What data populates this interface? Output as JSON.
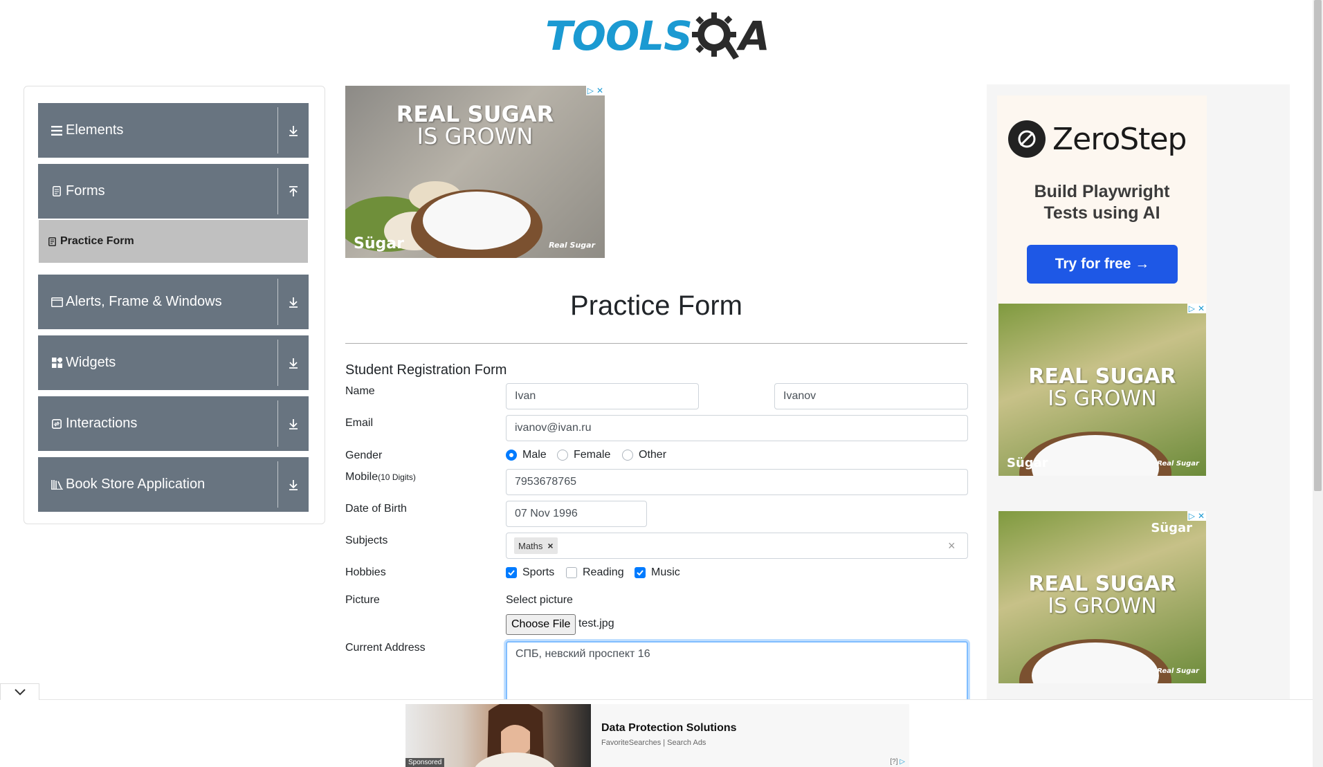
{
  "header": {
    "logo_text": "TOOLS",
    "logo_suffix": "A"
  },
  "sidebar": {
    "groups": [
      {
        "label": "Elements",
        "icon": "menu-icon",
        "toggle": "download-icon"
      },
      {
        "label": "Forms",
        "icon": "document-icon",
        "toggle": "upload-icon"
      },
      {
        "label": "Alerts, Frame & Windows",
        "icon": "window-icon",
        "toggle": "download-icon"
      },
      {
        "label": "Widgets",
        "icon": "widgets-icon",
        "toggle": "download-icon"
      },
      {
        "label": "Interactions",
        "icon": "interactions-icon",
        "toggle": "download-icon"
      },
      {
        "label": "Book Store Application",
        "icon": "books-icon",
        "toggle": "download-icon"
      }
    ],
    "active_item": {
      "label": "Practice Form",
      "icon": "form-icon"
    }
  },
  "top_ad": {
    "line1": "REAL SUGAR",
    "line2": "IS GROWN",
    "brand": "Sügar",
    "badge": "Real Sugar"
  },
  "main": {
    "page_title": "Practice Form",
    "form_title": "Student Registration Form",
    "labels": {
      "name": "Name",
      "email": "Email",
      "gender": "Gender",
      "mobile": "Mobile",
      "mobile_hint": "(10 Digits)",
      "dob": "Date of Birth",
      "subjects": "Subjects",
      "hobbies": "Hobbies",
      "picture": "Picture",
      "address": "Current Address"
    },
    "first_name": "Ivan",
    "last_name": "Ivanov",
    "email": "ivanov@ivan.ru",
    "gender_options": [
      "Male",
      "Female",
      "Other"
    ],
    "gender_selected": "Male",
    "mobile": "7953678765",
    "dob": "07 Nov 1996",
    "subjects": [
      "Maths"
    ],
    "subject_remove": "×",
    "subjects_clear": "×",
    "hobbies": [
      {
        "label": "Sports",
        "checked": true
      },
      {
        "label": "Reading",
        "checked": false
      },
      {
        "label": "Music",
        "checked": true
      }
    ],
    "picture_label": "Select picture",
    "choose_file": "Choose File",
    "file_name": "test.jpg",
    "address": "СПБ, невский проспект 16"
  },
  "right_ads": {
    "zerostep": {
      "name": "ZeroStep",
      "tagline_1": "Build Playwright",
      "tagline_2": "Tests using AI",
      "cta": "Try for free →"
    },
    "sugar1": {
      "line1": "REAL SUGAR",
      "line2": "IS GROWN",
      "brand": "Sügar",
      "badge": "Real Sugar"
    },
    "sugar2": {
      "line1": "REAL SUGAR",
      "line2": "IS GROWN",
      "brand": "Sügar",
      "badge": "Real Sugar"
    }
  },
  "bottom_ad": {
    "title": "Data Protection Solutions",
    "source": "FavoriteSearches | Search Ads",
    "sponsored": "Sponsored",
    "info": "[?]"
  },
  "colors": {
    "sidebar_group": "#687480",
    "active_item": "#c0c0c0",
    "accent": "#007bff",
    "logo": "#1b9ad2",
    "cta": "#1e58e6"
  }
}
